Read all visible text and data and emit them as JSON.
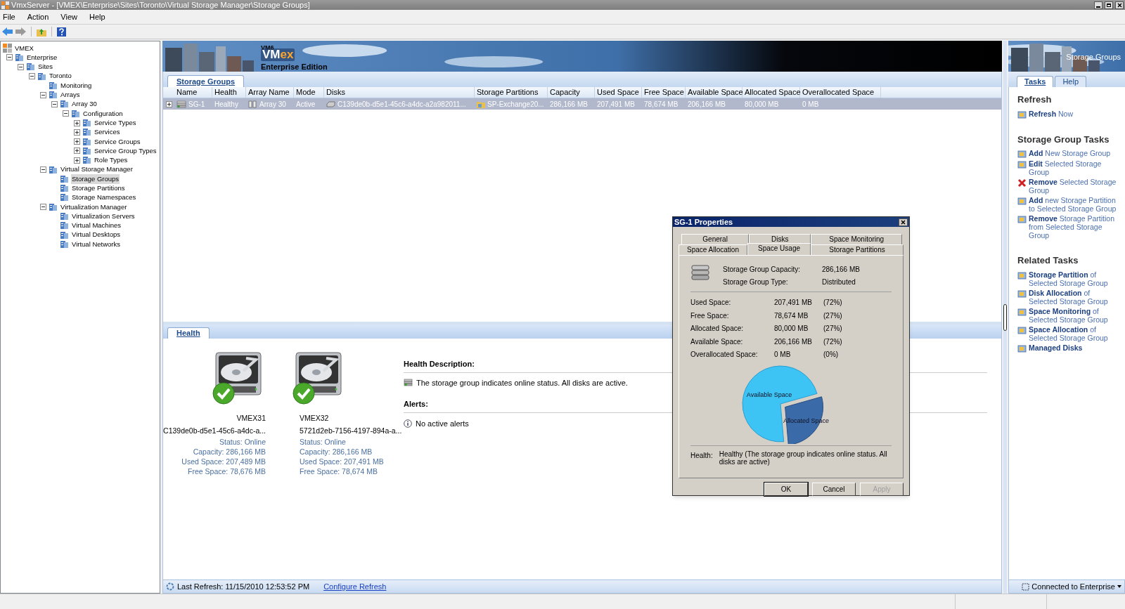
{
  "window": {
    "title": "VmxServer - [VMEX\\Enterprise\\Sites\\Toronto\\Virtual Storage Manager\\Storage Groups]"
  },
  "menu": [
    "File",
    "Action",
    "View",
    "Help"
  ],
  "tree": [
    {
      "label": "VMEX",
      "selected": false,
      "children": [
        {
          "label": "Enterprise",
          "selected": false,
          "expanded": true,
          "children": [
            {
              "label": "Sites",
              "selected": false,
              "expanded": true,
              "children": [
                {
                  "label": "Toronto",
                  "selected": false,
                  "expanded": true,
                  "children": [
                    {
                      "label": "Monitoring",
                      "selected": false
                    },
                    {
                      "label": "Arrays",
                      "selected": false,
                      "expanded": true,
                      "children": [
                        {
                          "label": "Array 30",
                          "selected": false,
                          "expanded": true,
                          "children": [
                            {
                              "label": "Configuration",
                              "selected": false,
                              "expanded": true,
                              "children": [
                                {
                                  "label": "Service Types",
                                  "selected": false,
                                  "expanded": false
                                },
                                {
                                  "label": "Services",
                                  "selected": false,
                                  "expanded": false
                                },
                                {
                                  "label": "Service Groups",
                                  "selected": false,
                                  "expanded": false
                                },
                                {
                                  "label": "Service Group Types",
                                  "selected": false,
                                  "expanded": false
                                },
                                {
                                  "label": "Role Types",
                                  "selected": false,
                                  "expanded": false
                                }
                              ]
                            }
                          ]
                        }
                      ]
                    },
                    {
                      "label": "Virtual Storage Manager",
                      "selected": false,
                      "expanded": true,
                      "children": [
                        {
                          "label": "Storage Groups",
                          "selected": true
                        },
                        {
                          "label": "Storage Partitions",
                          "selected": false
                        },
                        {
                          "label": "Storage Namespaces",
                          "selected": false
                        }
                      ]
                    },
                    {
                      "label": "Virtualization Manager",
                      "selected": false,
                      "expanded": true,
                      "children": [
                        {
                          "label": "Virtualization Servers",
                          "selected": false
                        },
                        {
                          "label": "Virtual Machines",
                          "selected": false
                        },
                        {
                          "label": "Virtual Desktops",
                          "selected": false
                        },
                        {
                          "label": "Virtual Networks",
                          "selected": false
                        }
                      ]
                    }
                  ]
                }
              ]
            }
          ]
        }
      ]
    }
  ],
  "banner": {
    "version": "VM6",
    "logo_main": "VM",
    "logo_accent": "ex",
    "edition": "Enterprise Edition",
    "side_title": "Storage Groups"
  },
  "main_tab": "Storage Groups",
  "table": {
    "columns": [
      "Name",
      "Health",
      "Array Name",
      "Mode",
      "Disks",
      "Storage Partitions",
      "Capacity",
      "Used Space",
      "Free Space",
      "Available Space",
      "Allocated Space",
      "Overallocated Space"
    ],
    "rows": [
      {
        "selected": true,
        "expanded": false,
        "cells": [
          "SG-1",
          "Healthy",
          "Array 30",
          "Active",
          "C139de0b-d5e1-45c6-a4dc-a2a982011...",
          "SP-Exchange20...",
          "286,166 MB",
          "207,491 MB",
          "78,674 MB",
          "206,166 MB",
          "80,000 MB",
          "0 MB"
        ]
      }
    ]
  },
  "health": {
    "tab": "Health",
    "disks": [
      {
        "name": "VMEX31",
        "id": "C139de0b-d5e1-45c6-a4dc-a...",
        "details": [
          "Status: Online",
          "Capacity: 286,166 MB",
          "Used Space: 207,489 MB",
          "Free Space: 78,676 MB"
        ]
      },
      {
        "name": "VMEX32",
        "id": "5721d2eb-7156-4197-894a-a...",
        "details": [
          "Status: Online",
          "Capacity: 286,166 MB",
          "Used Space: 207,491 MB",
          "Free Space: 78,674 MB"
        ]
      }
    ],
    "description_title": "Health Description:",
    "description": "The storage group indicates online status. All disks are active.",
    "alerts_title": "Alerts:",
    "alerts": "No active alerts"
  },
  "dialog": {
    "title": "SG-1 Properties",
    "tab_rows": [
      {
        "tabs": [
          {
            "label": "General",
            "selected": false
          },
          {
            "label": "Disks",
            "selected": false
          },
          {
            "label": "Space Monitoring",
            "selected": false
          }
        ]
      },
      {
        "tabs": [
          {
            "label": "Space Allocation",
            "selected": false
          },
          {
            "label": "Space Usage",
            "selected": true
          },
          {
            "label": "Storage Partitions",
            "selected": false
          }
        ]
      }
    ],
    "summary": [
      {
        "label": "Storage Group Capacity:",
        "value": "286,166 MB"
      },
      {
        "label": "Storage Group Type:",
        "value": "Distributed"
      }
    ],
    "stats": [
      {
        "label": "Used Space:",
        "value": "207,491 MB",
        "percent": "(72%)"
      },
      {
        "label": "Free Space:",
        "value": "78,674 MB",
        "percent": "(27%)"
      },
      {
        "label": "Allocated Space:",
        "value": "80,000 MB",
        "percent": "(27%)"
      },
      {
        "label": "Available Space:",
        "value": "206,166 MB",
        "percent": "(72%)"
      },
      {
        "label": "Overallocated Space:",
        "value": "0 MB",
        "percent": "(0%)"
      }
    ],
    "chart_data": {
      "type": "pie",
      "categories": [
        "Available Space",
        "Allocated Space"
      ],
      "values": [
        72,
        28
      ]
    },
    "health_label": "Health:",
    "health_text": "Healthy (The storage group indicates online status. All disks are active)",
    "buttons": [
      {
        "label": "OK",
        "disabled": false
      },
      {
        "label": "Cancel",
        "disabled": false
      },
      {
        "label": "Apply",
        "disabled": true
      }
    ]
  },
  "side": {
    "tabs": [
      {
        "label": "Tasks",
        "selected": true
      },
      {
        "label": "Help",
        "selected": false
      }
    ],
    "sections": [
      {
        "title": "Refresh",
        "links": [
          "**Refresh** Now"
        ]
      },
      {
        "title": "Storage Group Tasks",
        "links": [
          "**Add** New Storage   Group",
          "**Edit** Selected Storage Group",
          "**Remove** Selected Storage Group",
          "**Add** new Storage Partition to Selected Storage Group",
          "**Remove** Storage Partition from Selected Storage Group"
        ]
      },
      {
        "title": "Related Tasks",
        "links": [
          "**Storage Partition** of Selected Storage Group",
          "**Disk Allocation** of Selected Storage Group",
          "**Space Monitoring** of Selected Storage Group",
          "**Space Allocation** of Selected Storage Group",
          "**Managed Disks**"
        ]
      }
    ]
  },
  "footer": {
    "last_refresh": "Last Refresh:  11/15/2010 12:53:52 PM",
    "configure": "Configure Refresh",
    "connection": "Connected to Enterprise"
  }
}
